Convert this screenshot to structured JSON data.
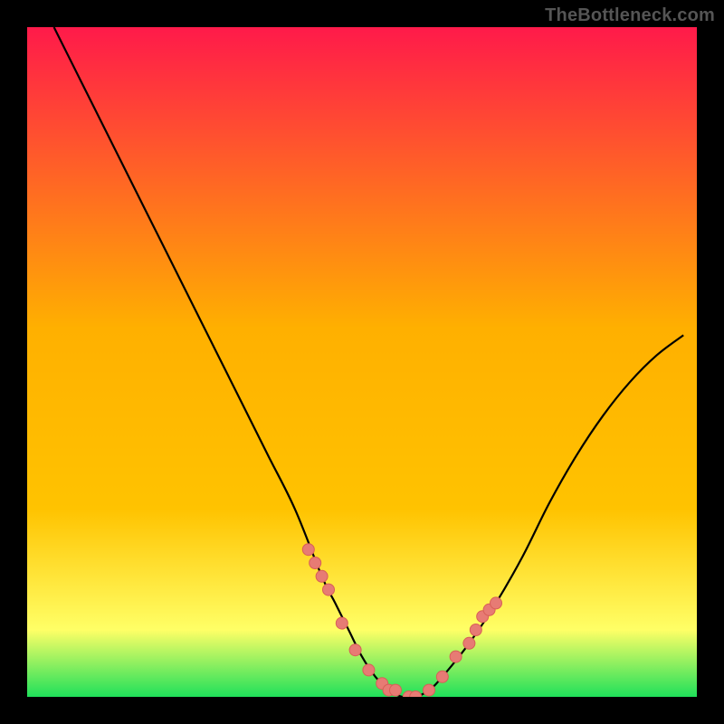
{
  "watermark": "TheBottleneck.com",
  "colors": {
    "bg": "#000000",
    "curve": "#000000",
    "dot_fill": "#e77b74",
    "dot_stroke": "#d85f57",
    "grad_top": "#ff1a4a",
    "grad_mid": "#ffc300",
    "grad_low": "#ffff66",
    "grad_bottom": "#1fe05a"
  },
  "chart_data": {
    "type": "line",
    "title": "",
    "xlabel": "",
    "ylabel": "",
    "xlim": [
      0,
      100
    ],
    "ylim": [
      0,
      100
    ],
    "series": [
      {
        "name": "bottleneck-curve",
        "x": [
          4,
          8,
          12,
          16,
          20,
          24,
          28,
          32,
          36,
          40,
          44,
          46,
          48,
          50,
          52,
          54,
          56,
          58,
          60,
          62,
          66,
          70,
          74,
          78,
          82,
          86,
          90,
          94,
          98
        ],
        "y": [
          100,
          92,
          84,
          76,
          68,
          60,
          52,
          44,
          36,
          28,
          18,
          14,
          10,
          6,
          3,
          1,
          0,
          0,
          1,
          3,
          8,
          14,
          21,
          29,
          36,
          42,
          47,
          51,
          54
        ]
      }
    ],
    "highlight_points": {
      "name": "optimal-zone-dots",
      "x": [
        42,
        43,
        44,
        45,
        47,
        49,
        51,
        53,
        54,
        55,
        57,
        58,
        60,
        62,
        64,
        66,
        67,
        68,
        69,
        70
      ],
      "y": [
        22,
        20,
        18,
        16,
        11,
        7,
        4,
        2,
        1,
        1,
        0,
        0,
        1,
        3,
        6,
        8,
        10,
        12,
        13,
        14
      ]
    }
  }
}
